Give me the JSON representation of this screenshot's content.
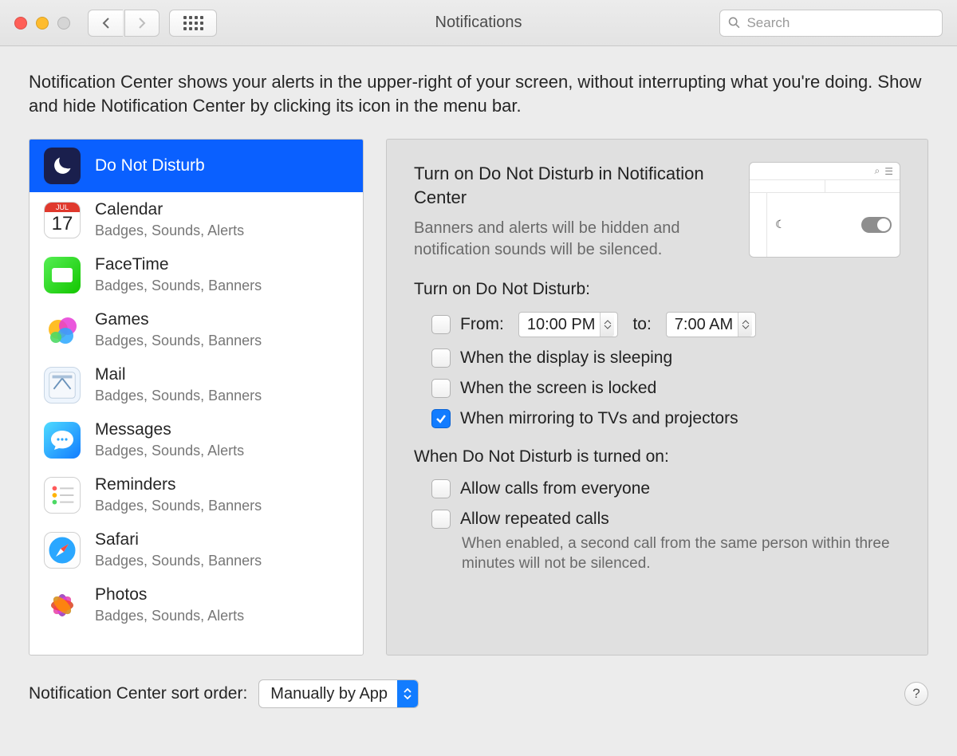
{
  "window": {
    "title": "Notifications",
    "search_placeholder": "Search"
  },
  "intro": "Notification Center shows your alerts in the upper-right of your screen, without interrupting what you're doing. Show and hide Notification Center by clicking its icon in the menu bar.",
  "sidebar": {
    "items": [
      {
        "name": "Do Not Disturb",
        "sub": "",
        "icon": "moon",
        "selected": true
      },
      {
        "name": "Calendar",
        "sub": "Badges, Sounds, Alerts",
        "icon": "calendar",
        "date_label": "JUL",
        "date_day": "17"
      },
      {
        "name": "FaceTime",
        "sub": "Badges, Sounds, Banners",
        "icon": "facetime"
      },
      {
        "name": "Games",
        "sub": "Badges, Sounds, Banners",
        "icon": "games"
      },
      {
        "name": "Mail",
        "sub": "Badges, Sounds, Banners",
        "icon": "mail"
      },
      {
        "name": "Messages",
        "sub": "Badges, Sounds, Alerts",
        "icon": "messages"
      },
      {
        "name": "Reminders",
        "sub": "Badges, Sounds, Banners",
        "icon": "reminders"
      },
      {
        "name": "Safari",
        "sub": "Badges, Sounds, Banners",
        "icon": "safari"
      },
      {
        "name": "Photos",
        "sub": "Badges, Sounds, Alerts",
        "icon": "photos"
      }
    ]
  },
  "panel": {
    "heading": "Turn on Do Not Disturb in Notification Center",
    "desc": "Banners and alerts will be hidden and notification sounds will be silenced.",
    "section_turn_on": "Turn on Do Not Disturb:",
    "from_label": "From:",
    "from_value": "10:00 PM",
    "to_label": "to:",
    "to_value": "7:00 AM",
    "check_from": false,
    "check_sleep_label": "When the display is sleeping",
    "check_sleep": false,
    "check_locked_label": "When the screen is locked",
    "check_locked": false,
    "check_mirror_label": "When mirroring to TVs and projectors",
    "check_mirror": true,
    "section_when_on": "When Do Not Disturb is turned on:",
    "check_everyone_label": "Allow calls from everyone",
    "check_everyone": false,
    "check_repeated_label": "Allow repeated calls",
    "check_repeated": false,
    "repeated_help": "When enabled, a second call from the same person within three minutes will not be silenced."
  },
  "footer": {
    "sort_label": "Notification Center sort order:",
    "sort_value": "Manually by App"
  }
}
